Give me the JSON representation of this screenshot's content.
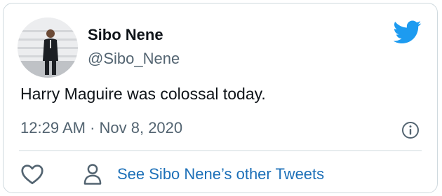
{
  "author": {
    "display_name": "Sibo Nene",
    "handle": "@Sibo_Nene"
  },
  "tweet": {
    "text": "Harry Maguire was colossal today.",
    "timestamp": "12:29 AM · Nov 8, 2020"
  },
  "actions": {
    "other_tweets_label": "See Sibo Nene’s other Tweets"
  },
  "icons": {
    "brand": "twitter-bird-icon",
    "info": "info-icon",
    "like": "heart-icon",
    "profile": "person-icon"
  },
  "colors": {
    "twitter_blue": "#1d9bf0",
    "link_blue": "#1d70b8",
    "secondary_text": "#536471",
    "primary_text": "#0f1419",
    "border": "#cfd9de"
  }
}
